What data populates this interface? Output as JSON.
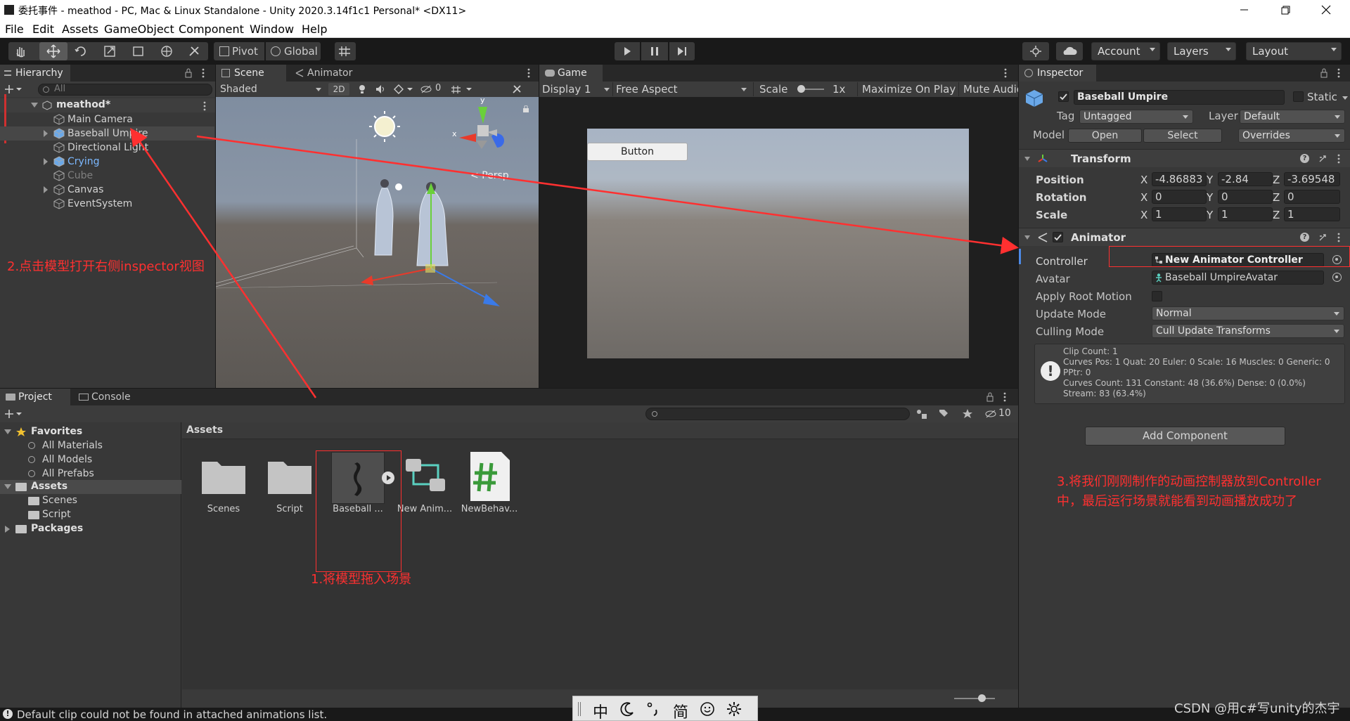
{
  "window": {
    "title": "委托事件 - meathod - PC, Mac & Linux Standalone - Unity 2020.3.14f1c1 Personal* <DX11>"
  },
  "menu": [
    "File",
    "Edit",
    "Assets",
    "GameObject",
    "Component",
    "Window",
    "Help"
  ],
  "toolbar": {
    "pivot": "Pivot",
    "global": "Global",
    "account": "Account",
    "layers": "Layers",
    "layout": "Layout"
  },
  "hierarchy": {
    "tab": "Hierarchy",
    "search_placeholder": "All",
    "scene": "meathod*",
    "items": [
      {
        "label": "Main Camera",
        "expandable": false,
        "color": "#d2d2d2"
      },
      {
        "label": "Baseball Umpire",
        "expandable": true,
        "color": "#d2d2d2"
      },
      {
        "label": "Directional Light",
        "expandable": false,
        "color": "#d2d2d2"
      },
      {
        "label": "Crying",
        "expandable": true,
        "color": "#7cb8ff"
      },
      {
        "label": "Cube",
        "expandable": false,
        "color": "#7f7f7f"
      },
      {
        "label": "Canvas",
        "expandable": true,
        "color": "#d2d2d2"
      },
      {
        "label": "EventSystem",
        "expandable": false,
        "color": "#d2d2d2"
      }
    ]
  },
  "scene": {
    "tab_scene": "Scene",
    "tab_animator": "Animator",
    "shading": "Shaded",
    "two_d": "2D",
    "hidden_count": "0",
    "persp": "Persp",
    "gizmo_x": "x",
    "gizmo_y": "y"
  },
  "game": {
    "tab": "Game",
    "display": "Display 1",
    "aspect": "Free Aspect",
    "scale_label": "Scale",
    "scale_value": "1x",
    "maximize": "Maximize On Play",
    "mute": "Mute Audio",
    "button": "Button"
  },
  "inspector": {
    "tab": "Inspector",
    "object_name": "Baseball Umpire",
    "static_label": "Static",
    "tag_label": "Tag",
    "tag_value": "Untagged",
    "layer_label": "Layer",
    "layer_value": "Default",
    "model_label": "Model",
    "open": "Open",
    "select": "Select",
    "overrides": "Overrides",
    "transform": {
      "title": "Transform",
      "position_label": "Position",
      "rotation_label": "Rotation",
      "scale_label": "Scale",
      "position": {
        "x": "-4.86883",
        "y": "-2.84",
        "z": "-3.69548"
      },
      "rotation": {
        "x": "0",
        "y": "0",
        "z": "0"
      },
      "scale": {
        "x": "1",
        "y": "1",
        "z": "1"
      }
    },
    "animator": {
      "title": "Animator",
      "controller_label": "Controller",
      "controller_value": "New Animator Controller",
      "avatar_label": "Avatar",
      "avatar_value": "Baseball UmpireAvatar",
      "apply_root_motion_label": "Apply Root Motion",
      "update_mode_label": "Update Mode",
      "update_mode_value": "Normal",
      "culling_mode_label": "Culling Mode",
      "culling_mode_value": "Cull Update Transforms",
      "info_lines": [
        "Clip Count: 1",
        "Curves Pos: 1 Quat: 20 Euler: 0 Scale: 16 Muscles: 0 Generic: 0",
        "PPtr: 0",
        "Curves Count: 131 Constant: 48 (36.6%) Dense: 0 (0.0%)",
        "Stream: 83 (63.4%)"
      ]
    },
    "add_component": "Add Component"
  },
  "project": {
    "tab_project": "Project",
    "tab_console": "Console",
    "hidden_count": "10",
    "favorites": "Favorites",
    "fav_items": [
      "All Materials",
      "All Models",
      "All Prefabs"
    ],
    "assets": "Assets",
    "asset_children": [
      "Scenes",
      "Script"
    ],
    "packages": "Packages",
    "breadcrumb": "Assets",
    "grid_items": [
      "Scenes",
      "Script",
      "Baseball ...",
      "New Anim...",
      "NewBehav..."
    ]
  },
  "status": {
    "message": "Default clip could not be found in attached animations list."
  },
  "ime": {
    "items": [
      "中",
      "简"
    ]
  },
  "annotations": {
    "step1": "1.将模型拖入场景",
    "step2": "2.点击模型打开右侧inspector视图",
    "step3": "3.将我们刚刚制作的动画控制器放到Controller中，最后运行场景就能看到动画播放成功了"
  },
  "watermark": "CSDN @用c#写unity的杰宇",
  "colors": {
    "annotation_red": "#ff3030",
    "accent_blue": "#4d8ae6",
    "panel_bg": "#383838"
  }
}
